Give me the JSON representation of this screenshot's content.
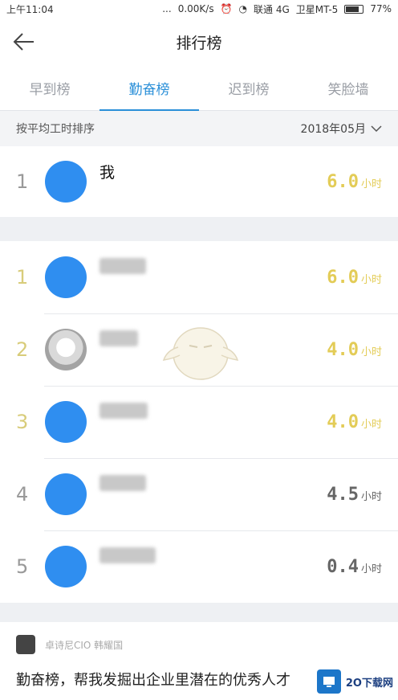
{
  "status": {
    "time": "上午11:04",
    "dots": "...",
    "speed": "0.00K/s",
    "carrier1": "联通 4G",
    "carrier2": "卫星MT-5",
    "battery": "77%",
    "battery_level": 0.77
  },
  "header": {
    "title": "排行榜"
  },
  "tabs": [
    {
      "label": "早到榜",
      "active": false
    },
    {
      "label": "勤奋榜",
      "active": true
    },
    {
      "label": "迟到榜",
      "active": false
    },
    {
      "label": "笑脸墙",
      "active": false
    }
  ],
  "sort": {
    "label": "按平均工时排序",
    "month": "2018年05月"
  },
  "me": {
    "rank": "1",
    "name": "我",
    "hours": "6.0",
    "unit": "小时"
  },
  "leaderboard": [
    {
      "rank": "1",
      "hours": "6.0",
      "unit": "小时"
    },
    {
      "rank": "2",
      "hours": "4.0",
      "unit": "小时"
    },
    {
      "rank": "3",
      "hours": "4.0",
      "unit": "小时"
    },
    {
      "rank": "4",
      "hours": "4.5",
      "unit": "小时"
    },
    {
      "rank": "5",
      "hours": "0.4",
      "unit": "小时"
    }
  ],
  "quote": {
    "author": "卓诗尼CIO 韩耀国",
    "text": "勤奋榜，帮我发掘出企业里潜在的优秀人才"
  },
  "watermark": {
    "text": "2O下载网"
  },
  "colors": {
    "accent": "#2a8fd8",
    "avatar": "#2f8ef0",
    "gold": "#e3cc57"
  }
}
